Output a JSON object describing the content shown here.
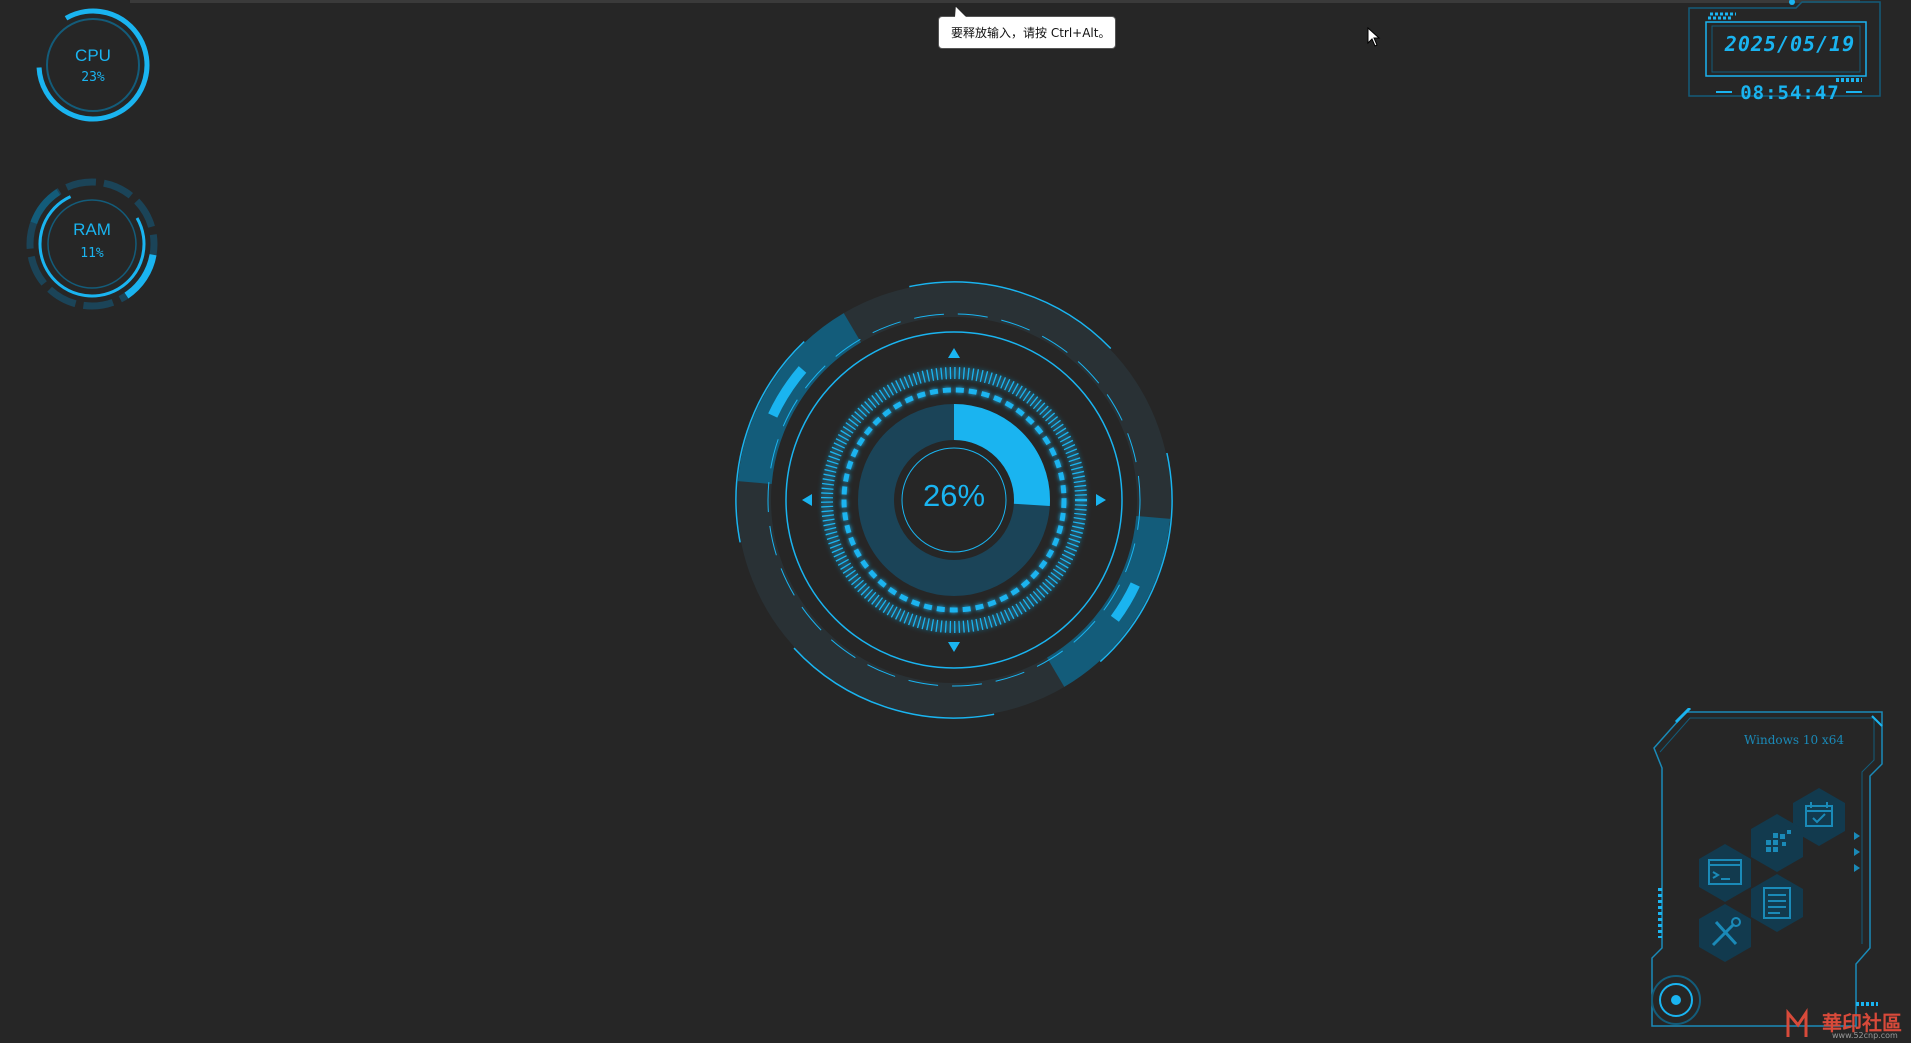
{
  "cpu": {
    "label": "CPU",
    "value": "23%",
    "fraction": 0.23
  },
  "ram": {
    "label": "RAM",
    "value": "11%",
    "fraction": 0.11
  },
  "tooltip": {
    "text": "要释放输入，请按 Ctrl+Alt。"
  },
  "clock": {
    "date": "2025/05/19",
    "time": "08:54:47"
  },
  "center": {
    "percent": "26%",
    "fraction": 0.26
  },
  "panel": {
    "os_label": "Windows 10 x64",
    "shortcuts": [
      {
        "icon": "calendar-icon"
      },
      {
        "icon": "apps-grid-icon"
      },
      {
        "icon": "terminal-icon"
      },
      {
        "icon": "list-icon"
      },
      {
        "icon": "tools-icon"
      }
    ]
  },
  "watermark": {
    "text": "華印社區",
    "url": "www.52cnp.com"
  },
  "colors": {
    "accent": "#1ab4f0",
    "dim": "#135c7a",
    "dark": "#1b4458",
    "background": "#262626"
  }
}
